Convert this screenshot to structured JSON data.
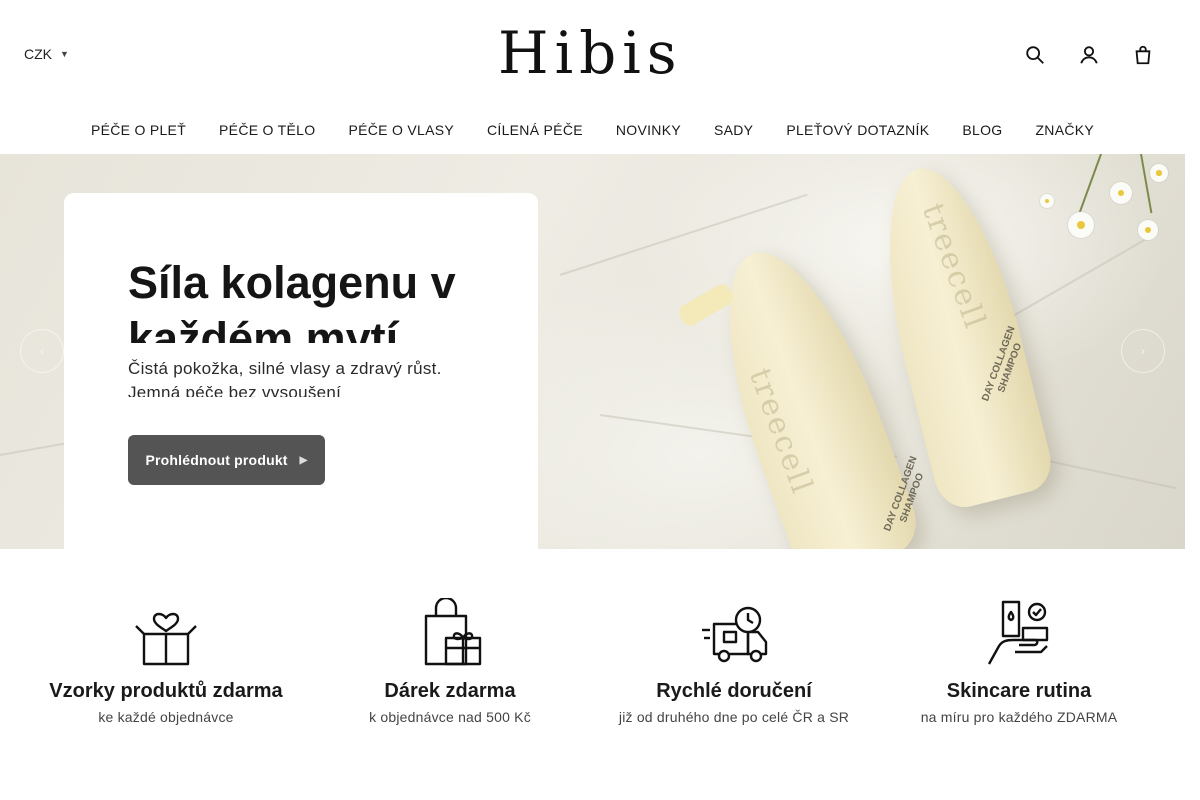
{
  "header": {
    "currency": "CZK",
    "logo_text": "Hibis",
    "icons": [
      "search-icon",
      "user-icon",
      "cart-icon"
    ]
  },
  "nav": {
    "items": [
      "PÉČE O PLEŤ",
      "PÉČE O TĚLO",
      "PÉČE O VLASY",
      "CÍLENÁ PÉČE",
      "NOVINKY",
      "SADY",
      "PLEŤOVÝ DOTAZNÍK",
      "BLOG",
      "ZNAČKY"
    ]
  },
  "hero": {
    "title": "Síla kolagenu v každém mytí",
    "subtitle": "Čistá pokožka, silné vlasy a zdravý růst. Jemná péče bez vysoušení",
    "button_label": "Prohlédnout produkt",
    "product_brand": "treecell",
    "bottle_label_1": "DAY COLLAGEN SHAMPOO",
    "bottle_label_2": "DAY COLLAGEN SHAMPOO"
  },
  "features": [
    {
      "icon": "gift-box-heart-icon",
      "title": "Vzorky produktů zdarma",
      "desc": "ke každé objednávce"
    },
    {
      "icon": "shopping-bag-gift-icon",
      "title": "Dárek zdarma",
      "desc": "k objednávce nad 500 Kč"
    },
    {
      "icon": "delivery-truck-icon",
      "title": "Rychlé doručení",
      "desc": "již od druhého dne po celé ČR a SR"
    },
    {
      "icon": "skincare-hand-icon",
      "title": "Skincare rutina",
      "desc": "na míru pro každého ZDARMA"
    }
  ]
}
